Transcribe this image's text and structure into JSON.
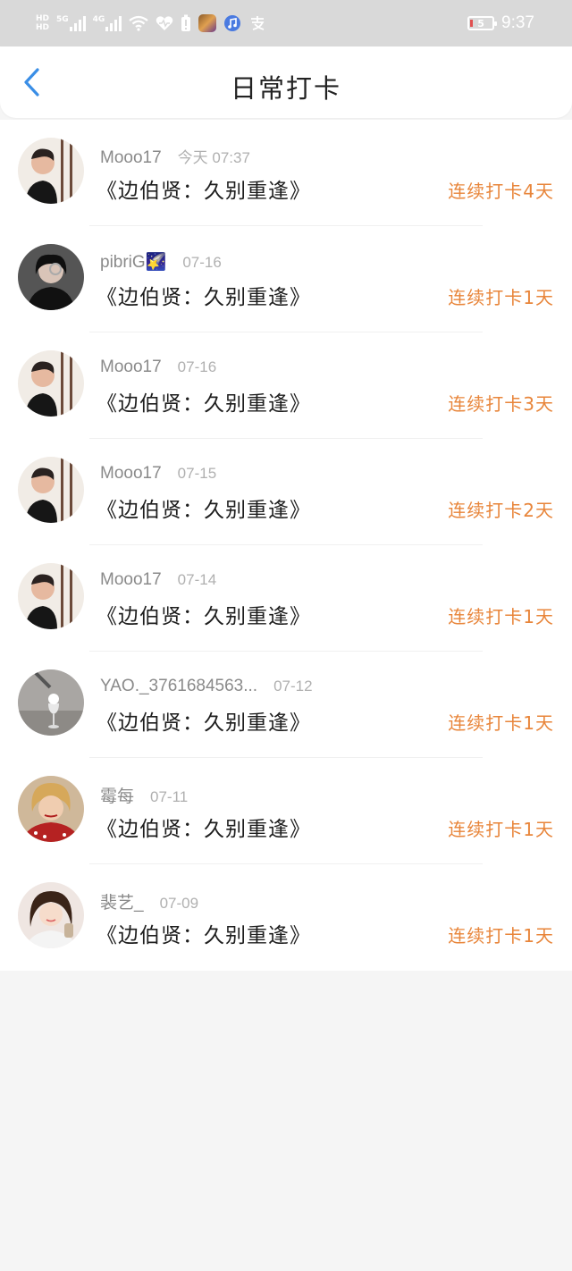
{
  "status_bar": {
    "hd_top": "HD",
    "hd_bottom": "HD",
    "net1": "5G",
    "net2": "4G",
    "battery_level": "5",
    "time": "9:37"
  },
  "header": {
    "title": "日常打卡"
  },
  "entries": [
    {
      "user": "Mooo17",
      "date": "今天 07:37",
      "book": "《边伯贤：久别重逢》",
      "streak": "连续打卡4天"
    },
    {
      "user": "pibriG🌠",
      "date": "07-16",
      "book": "《边伯贤：久别重逢》",
      "streak": "连续打卡1天"
    },
    {
      "user": "Mooo17",
      "date": "07-16",
      "book": "《边伯贤：久别重逢》",
      "streak": "连续打卡3天"
    },
    {
      "user": "Mooo17",
      "date": "07-15",
      "book": "《边伯贤：久别重逢》",
      "streak": "连续打卡2天"
    },
    {
      "user": "Mooo17",
      "date": "07-14",
      "book": "《边伯贤：久别重逢》",
      "streak": "连续打卡1天"
    },
    {
      "user": "YAO._3761684563...",
      "date": "07-12",
      "book": "《边伯贤：久别重逢》",
      "streak": "连续打卡1天"
    },
    {
      "user": "霉每",
      "date": "07-11",
      "book": "《边伯贤：久别重逢》",
      "streak": "连续打卡1天"
    },
    {
      "user": "裴艺_",
      "date": "07-09",
      "book": "《边伯贤：久别重逢》",
      "streak": "连续打卡1天"
    }
  ],
  "colors": {
    "accent_back": "#3a8ee6",
    "streak": "#e8853a",
    "status_bar": "#d9d9d9"
  }
}
